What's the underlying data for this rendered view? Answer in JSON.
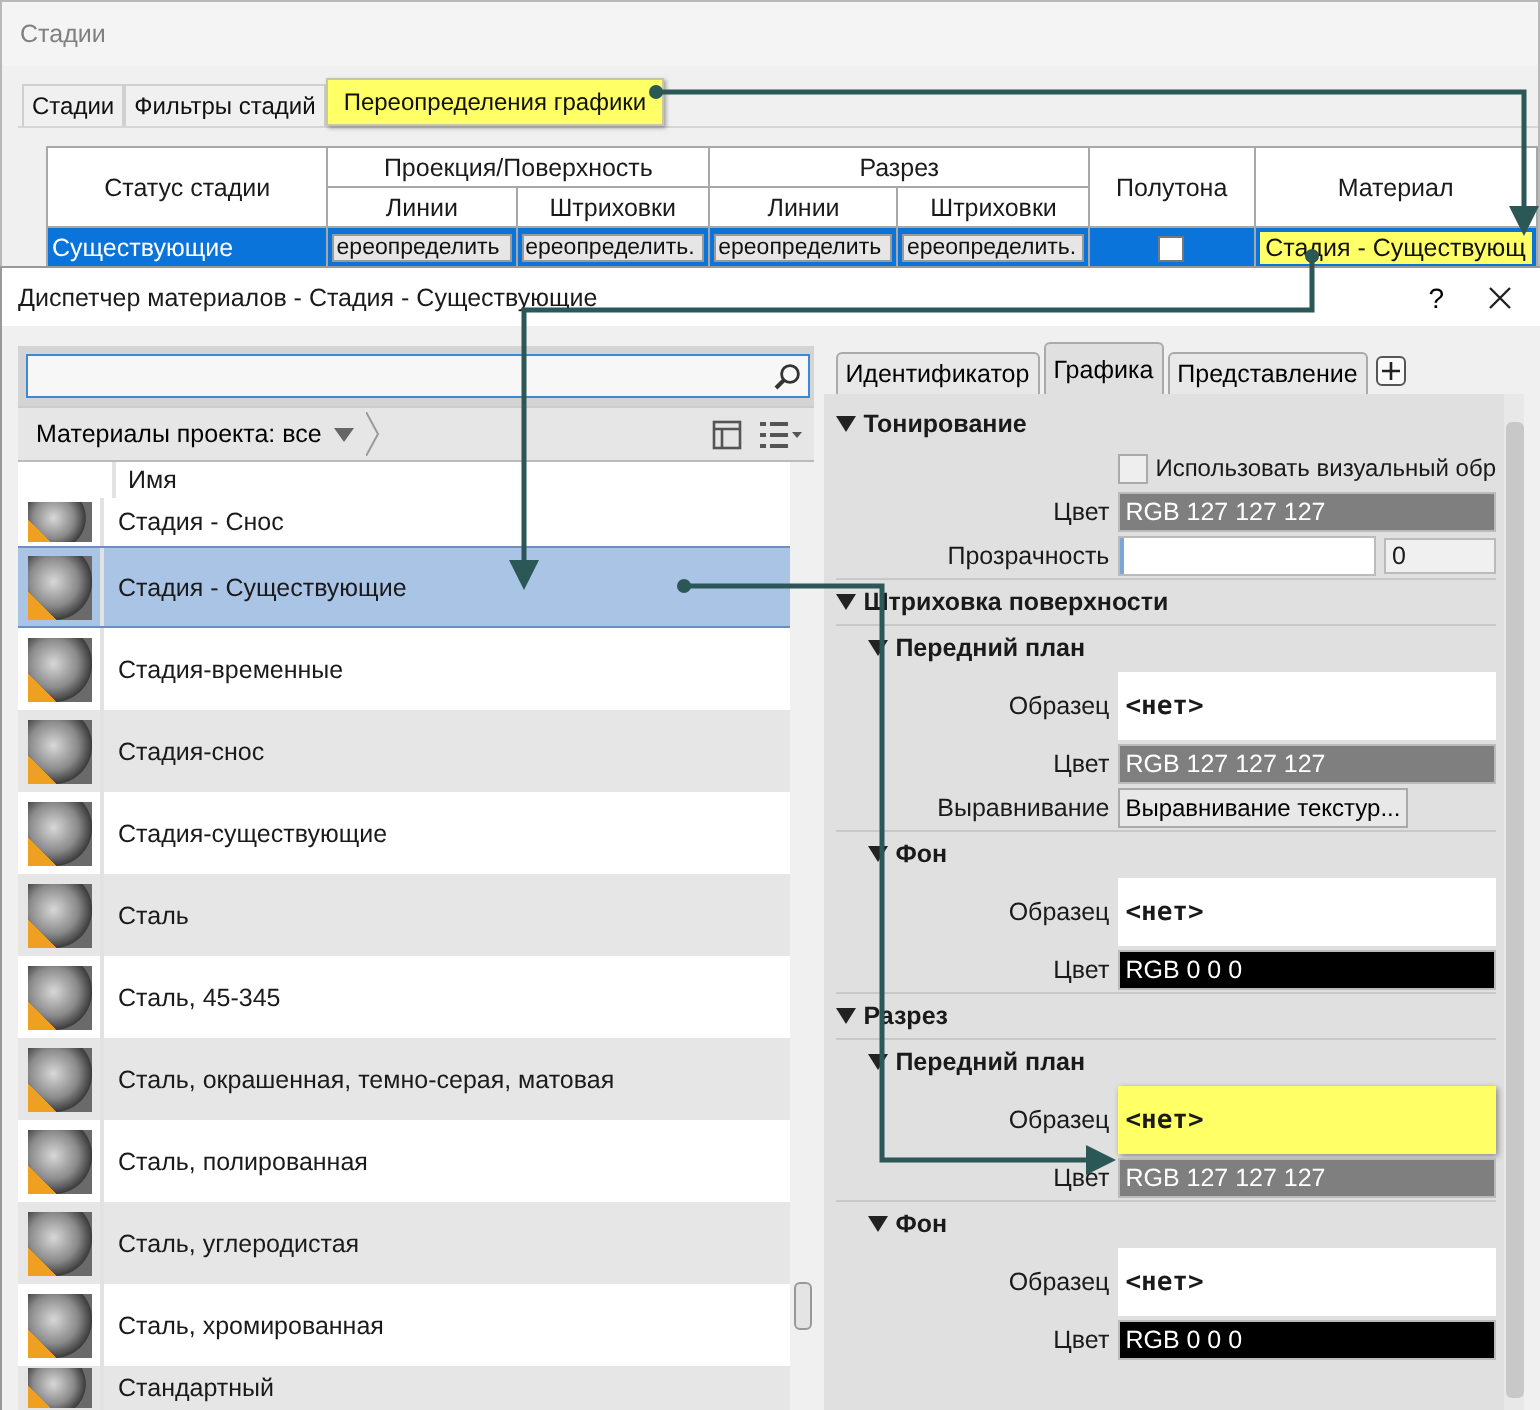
{
  "back_window": {
    "title": "Стадии",
    "tabs": [
      {
        "label": "Стадии",
        "selected": false
      },
      {
        "label": "Фильтры стадий",
        "selected": false
      },
      {
        "label": "Переопределения графики",
        "selected": true
      }
    ],
    "table": {
      "status_header": "Статус стадии",
      "header_groups": [
        {
          "label": "Проекция/Поверхность",
          "subcolumns": [
            "Линии",
            "Штриховки"
          ]
        },
        {
          "label": "Разрез",
          "subcolumns": [
            "Линии",
            "Штриховки"
          ]
        }
      ],
      "halftone_header": "Полутона",
      "material_header": "Материал",
      "rows": [
        {
          "status": "Существующие",
          "selected": true,
          "overrides": [
            "ереопределить",
            "ереопределить.",
            "ереопределить",
            "ереопределить."
          ],
          "halftone": false,
          "material": "Стадия - Существующ",
          "material_highlighted": true
        }
      ]
    }
  },
  "dialog": {
    "title": "Диспетчер материалов - Стадия - Существующие",
    "help": "?",
    "filter": "Материалы проекта: все",
    "list_header": "Имя",
    "materials": [
      {
        "name": "Стадия - Снос",
        "selected": false
      },
      {
        "name": "Стадия - Существующие",
        "selected": true
      },
      {
        "name": "Стадия-временные",
        "selected": false
      },
      {
        "name": "Стадия-снос",
        "selected": false
      },
      {
        "name": "Стадия-существующие",
        "selected": false
      },
      {
        "name": "Сталь",
        "selected": false
      },
      {
        "name": "Сталь, 45-345",
        "selected": false
      },
      {
        "name": "Сталь, окрашенная, темно-серая, матовая",
        "selected": false
      },
      {
        "name": "Сталь, полированная",
        "selected": false
      },
      {
        "name": "Сталь, углеродистая",
        "selected": false
      },
      {
        "name": "Сталь, хромированная",
        "selected": false
      },
      {
        "name": "Стандартный",
        "selected": false
      }
    ],
    "tabs": [
      {
        "label": "Идентификатор",
        "selected": false
      },
      {
        "label": "Графика",
        "selected": true
      },
      {
        "label": "Представление",
        "selected": false
      }
    ],
    "properties": [
      {
        "kind": "section",
        "label": "Тонирование",
        "expanded": true
      },
      {
        "kind": "checkbox",
        "label": "Использовать визуальный обр",
        "checked": false
      },
      {
        "kind": "color",
        "label": "Цвет",
        "value": "RGB 127 127 127",
        "color": "#7f7f7f"
      },
      {
        "kind": "transparency",
        "label": "Прозрачность",
        "value": "0",
        "level": 0
      },
      {
        "kind": "section",
        "label": "Штриховка поверхности",
        "expanded": true
      },
      {
        "kind": "subsection",
        "label": "Передний план",
        "expanded": true
      },
      {
        "kind": "pattern",
        "label": "Образец",
        "value": "<нет>",
        "highlighted": false
      },
      {
        "kind": "color",
        "label": "Цвет",
        "value": "RGB 127 127 127",
        "color": "#7f7f7f"
      },
      {
        "kind": "button",
        "label": "Выравнивание",
        "value": "Выравнивание текстур..."
      },
      {
        "kind": "subsection",
        "label": "Фон",
        "expanded": true
      },
      {
        "kind": "pattern",
        "label": "Образец",
        "value": "<нет>",
        "highlighted": false
      },
      {
        "kind": "color",
        "label": "Цвет",
        "value": "RGB 0 0 0",
        "color": "#000000"
      },
      {
        "kind": "section",
        "label": "Разрез",
        "expanded": true
      },
      {
        "kind": "subsection",
        "label": "Передний план",
        "expanded": true
      },
      {
        "kind": "pattern",
        "label": "Образец",
        "value": "<нет>",
        "highlighted": true
      },
      {
        "kind": "color",
        "label": "Цвет",
        "value": "RGB 127 127 127",
        "color": "#7f7f7f"
      },
      {
        "kind": "subsection",
        "label": "Фон",
        "expanded": true
      },
      {
        "kind": "pattern",
        "label": "Образец",
        "value": "<нет>",
        "highlighted": false
      },
      {
        "kind": "color",
        "label": "Цвет",
        "value": "RGB 0 0 0",
        "color": "#000000"
      }
    ]
  }
}
